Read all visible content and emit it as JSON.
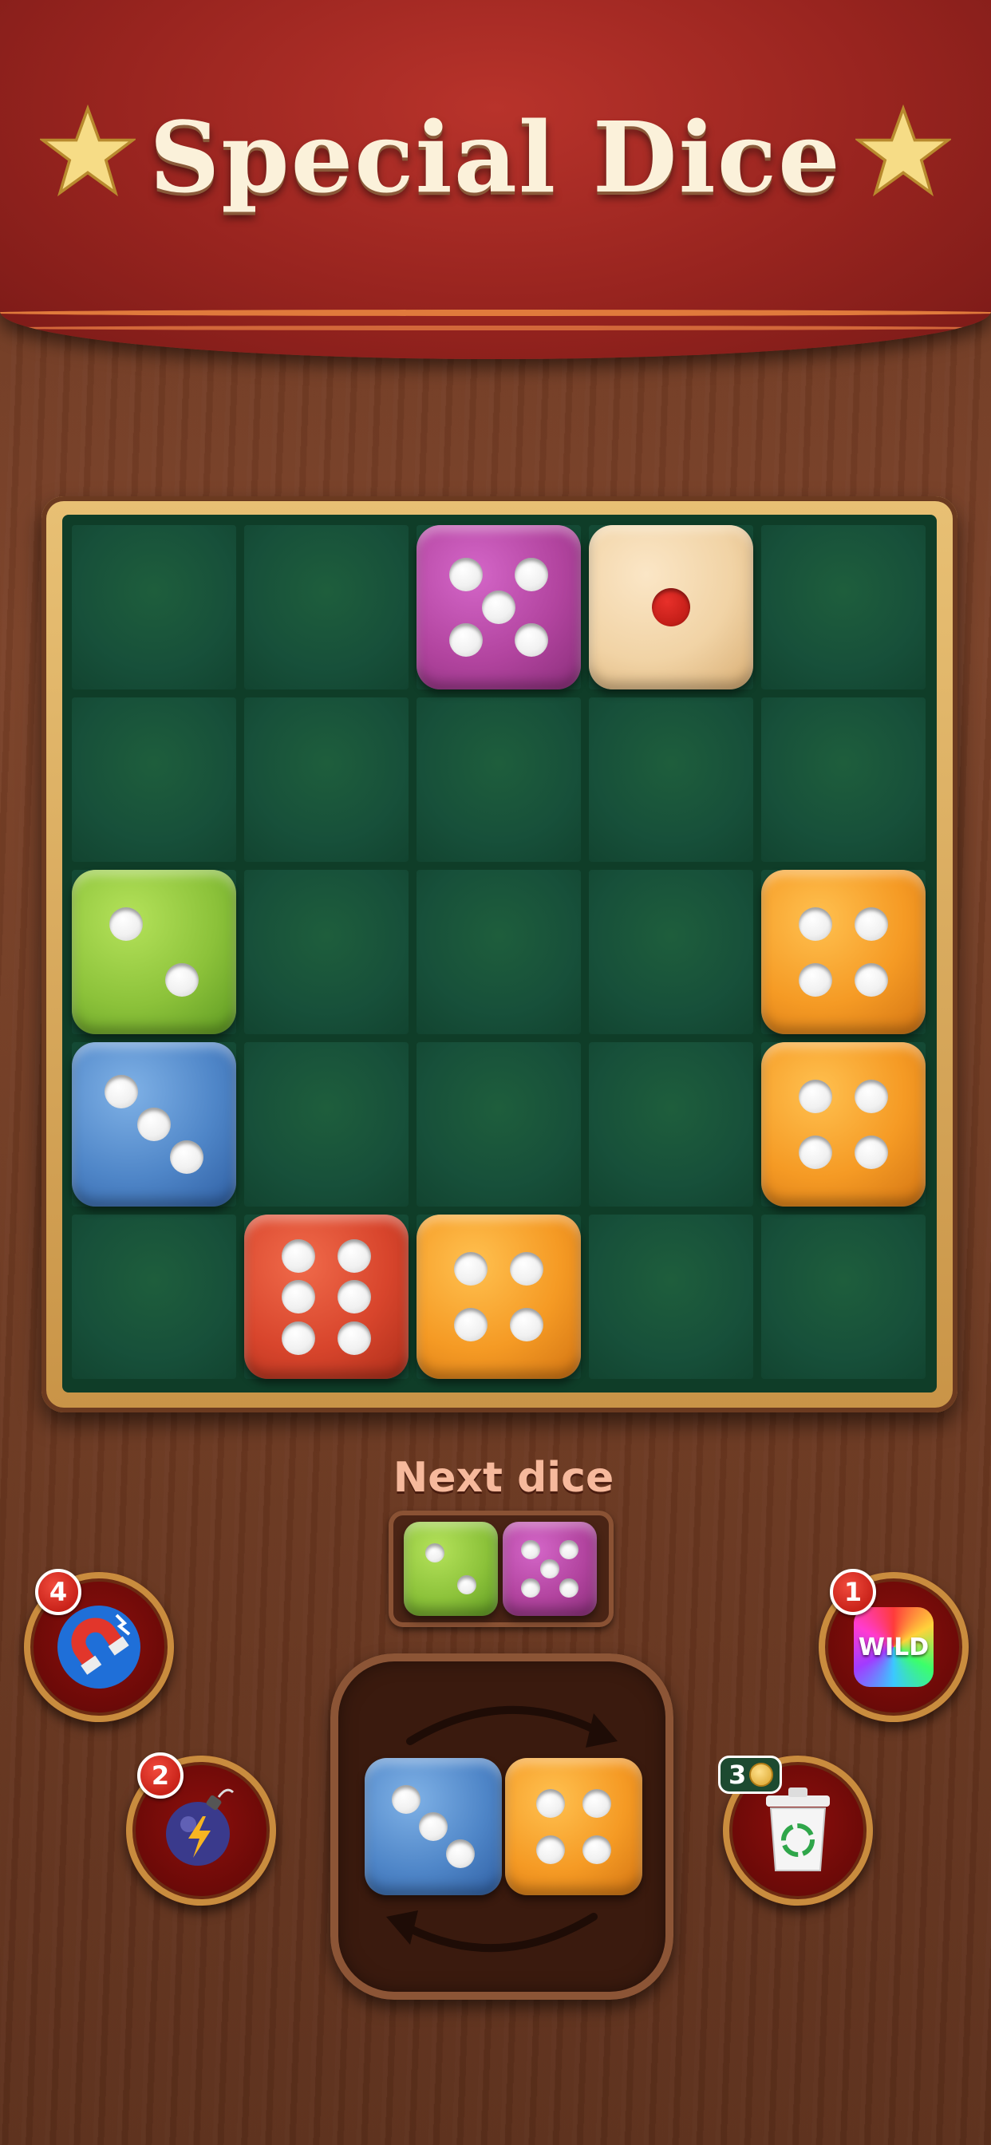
{
  "header": {
    "title": "Special Dice"
  },
  "colors": {
    "banner": "#98241f",
    "felt": "#17503a",
    "frame": "#c99447",
    "purple_die": "#b2449f",
    "wood_die": "#f1d3a5",
    "green_die": "#8cc23a",
    "blue_die": "#4f86c8",
    "orange_die": "#f59a24",
    "red_die": "#d8452c"
  },
  "board": {
    "columns": 5,
    "rows": 5,
    "dice": [
      {
        "row": 1,
        "col": 3,
        "color": "purple",
        "value": 5
      },
      {
        "row": 1,
        "col": 4,
        "color": "wood",
        "value": 1
      },
      {
        "row": 3,
        "col": 1,
        "color": "green",
        "value": 2
      },
      {
        "row": 3,
        "col": 5,
        "color": "orange",
        "value": 4
      },
      {
        "row": 4,
        "col": 1,
        "color": "blue",
        "value": 3
      },
      {
        "row": 4,
        "col": 5,
        "color": "orange",
        "value": 4
      },
      {
        "row": 5,
        "col": 2,
        "color": "red",
        "value": 6
      },
      {
        "row": 5,
        "col": 3,
        "color": "orange",
        "value": 4
      }
    ]
  },
  "next": {
    "label": "Next dice",
    "dice": [
      {
        "color": "green",
        "value": 2
      },
      {
        "color": "purple",
        "value": 5
      }
    ]
  },
  "current_piece": {
    "dice": [
      {
        "color": "blue",
        "value": 3
      },
      {
        "color": "orange",
        "value": 4
      }
    ],
    "rotate_icon": "rotate-arrows-icon"
  },
  "boosters": {
    "magnet": {
      "count": "4",
      "icon": "magnet-icon"
    },
    "bomb": {
      "count": "2",
      "icon": "bomb-icon"
    },
    "wild": {
      "count": "1",
      "icon": "wild-icon",
      "label": "WILD"
    },
    "trash": {
      "cost": "3",
      "icon": "trash-icon",
      "coin_icon": "coin-icon"
    }
  }
}
